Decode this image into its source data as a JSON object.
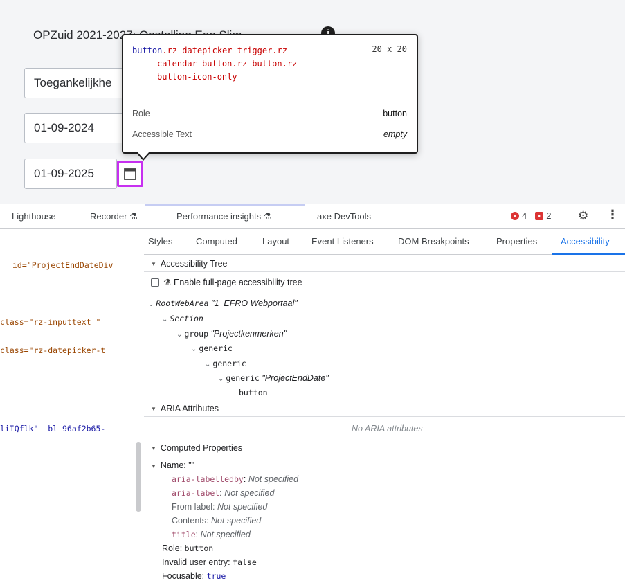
{
  "page": {
    "field_title": "OPZuid 2021-2027: Opstelling Een Slim",
    "field_access": "Toegankelijkhe",
    "field_start_date": "01-09-2024",
    "field_end_date": "01-09-2025",
    "info_glyph": "i",
    "calendar_icon": "calendar-icon"
  },
  "tooltip": {
    "selector_tag": "button",
    "selector_classes_line1": ".rz-datepicker-trigger.rz-",
    "selector_classes_line2": "calendar-button.rz-button.rz-",
    "selector_classes_line3": "button-icon-only",
    "size": "20 x 20",
    "role_label": "Role",
    "role_value": "button",
    "acc_text_label": "Accessible Text",
    "acc_text_value": "empty"
  },
  "devtools_tabs": {
    "lighthouse": "Lighthouse",
    "recorder": "Recorder",
    "performance": "Performance insights",
    "axe": "axe DevTools",
    "errors": "4",
    "issues": "2"
  },
  "elements": {
    "line1": "id=\"ProjectEndDateDiv",
    "line2": "class=\"rz-inputtext  \"",
    "line3": "class=\"rz-datepicker-t",
    "line4": "liIQflk\" _bl_96af2b65-"
  },
  "side_tabs": {
    "styles": "Styles",
    "computed": "Computed",
    "layout": "Layout",
    "event_listeners": "Event Listeners",
    "dom_breakpoints": "DOM Breakpoints",
    "properties": "Properties",
    "accessibility": "Accessibility"
  },
  "accessibility": {
    "tree_header": "Accessibility Tree",
    "enable_full_page": "Enable full-page accessibility tree",
    "root_role": "RootWebArea",
    "root_name": "\"1_EFRO Webportaal\"",
    "section": "Section",
    "group_role": "group",
    "group_name": "\"Projectkenmerken\"",
    "generic1": "generic",
    "generic2": "generic",
    "generic3": "generic",
    "generic3_name": "\"ProjectEndDate\"",
    "button": "button",
    "aria_header": "ARIA Attributes",
    "no_aria": "No ARIA attributes",
    "computed_header": "Computed Properties",
    "name_line": "Name: \"\"",
    "labelledby_key": "aria-labelledby",
    "labelledby_val": "Not specified",
    "label_key": "aria-label",
    "label_val": "Not specified",
    "from_label": "From label:",
    "from_label_val": "Not specified",
    "contents": "Contents:",
    "contents_val": "Not specified",
    "title_key": "title",
    "title_val": "Not specified",
    "role_key": "Role:",
    "role_val": "button",
    "invalid_key": "Invalid user entry:",
    "invalid_val": "false",
    "focusable_key": "Focusable:",
    "focusable_val": "true"
  }
}
